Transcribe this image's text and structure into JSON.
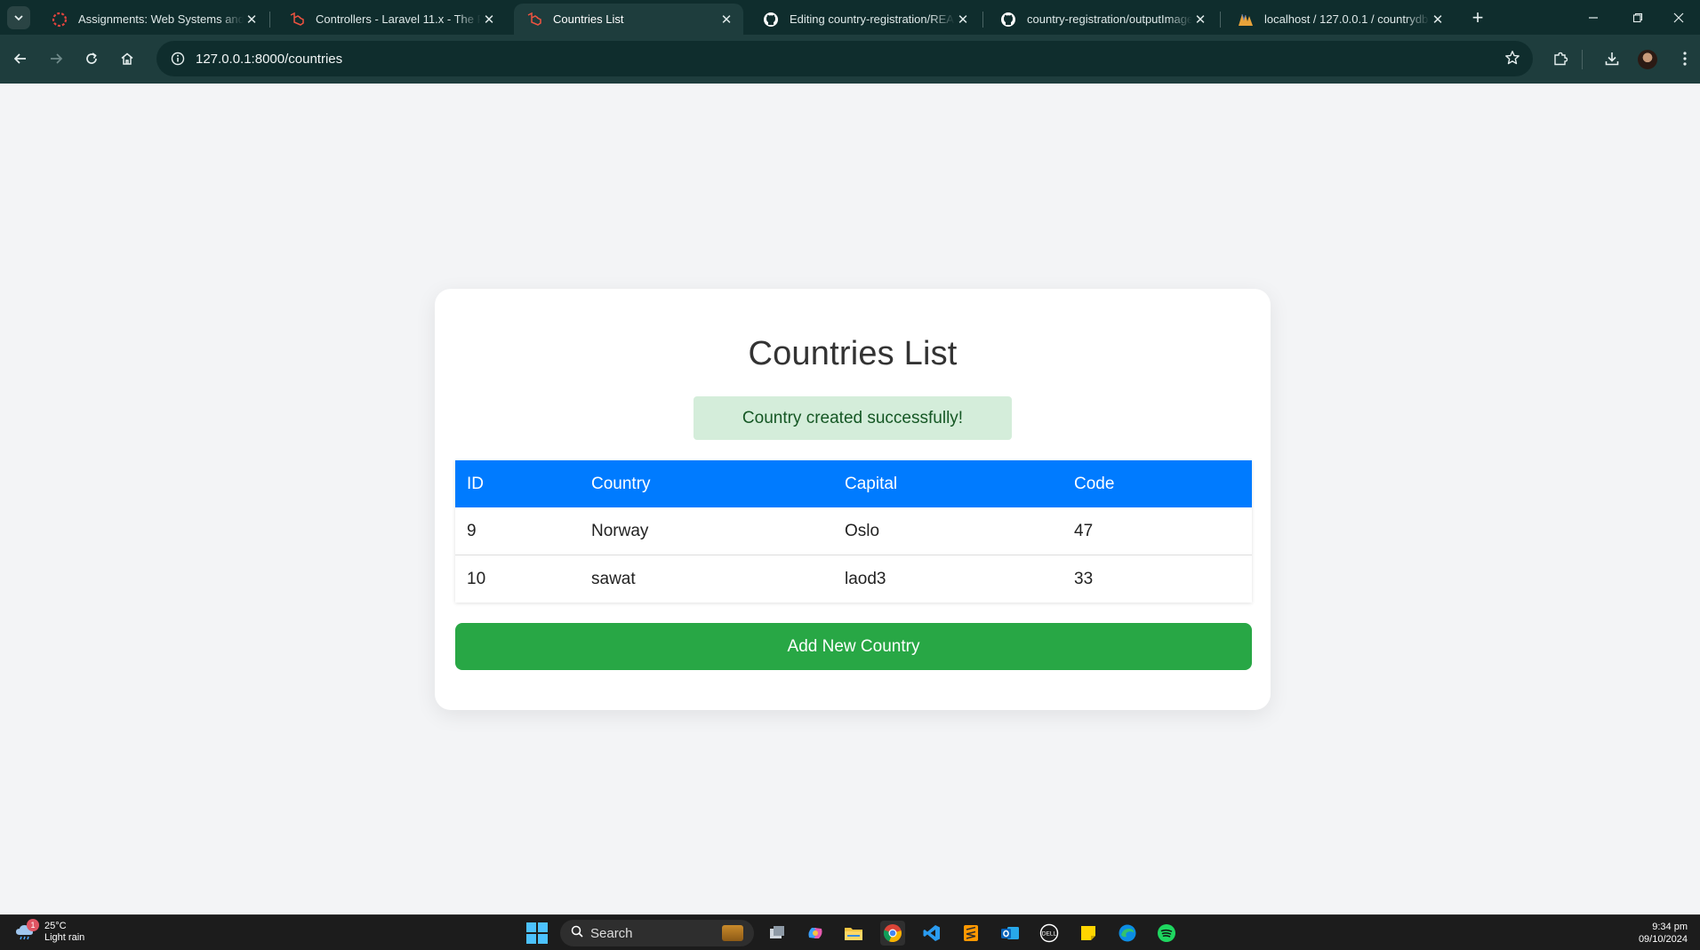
{
  "browser": {
    "tabs": [
      {
        "title": "Assignments: Web Systems and Te",
        "icon": "assignment-app-icon",
        "active": false
      },
      {
        "title": "Controllers - Laravel 11.x - The PHP",
        "icon": "laravel-icon",
        "active": false
      },
      {
        "title": "Countries List",
        "icon": "laravel-icon",
        "active": true
      },
      {
        "title": "Editing country-registration/README",
        "icon": "github-icon",
        "active": false
      },
      {
        "title": "country-registration/outputImages",
        "icon": "github-icon",
        "active": false
      },
      {
        "title": "localhost / 127.0.0.1 / countrydb /",
        "icon": "phpmyadmin-icon",
        "active": false
      }
    ],
    "address": {
      "url": "127.0.0.1:8000/countries"
    }
  },
  "page": {
    "title": "Countries List",
    "alert": "Country created successfully!",
    "table": {
      "headers": [
        "ID",
        "Country",
        "Capital",
        "Code"
      ],
      "rows": [
        [
          "9",
          "Norway",
          "Oslo",
          "47"
        ],
        [
          "10",
          "sawat",
          "laod3",
          "33"
        ]
      ]
    },
    "add_button": "Add New Country",
    "colors": {
      "header": "#007bff",
      "button": "#28a745",
      "alert_bg": "#d4edda",
      "alert_text": "#155724"
    }
  },
  "taskbar": {
    "weather": {
      "temp": "25°C",
      "condition": "Light rain",
      "badge": "1"
    },
    "search_placeholder": "Search",
    "clock": {
      "time": "9:34 pm",
      "date": "09/10/2024"
    }
  }
}
